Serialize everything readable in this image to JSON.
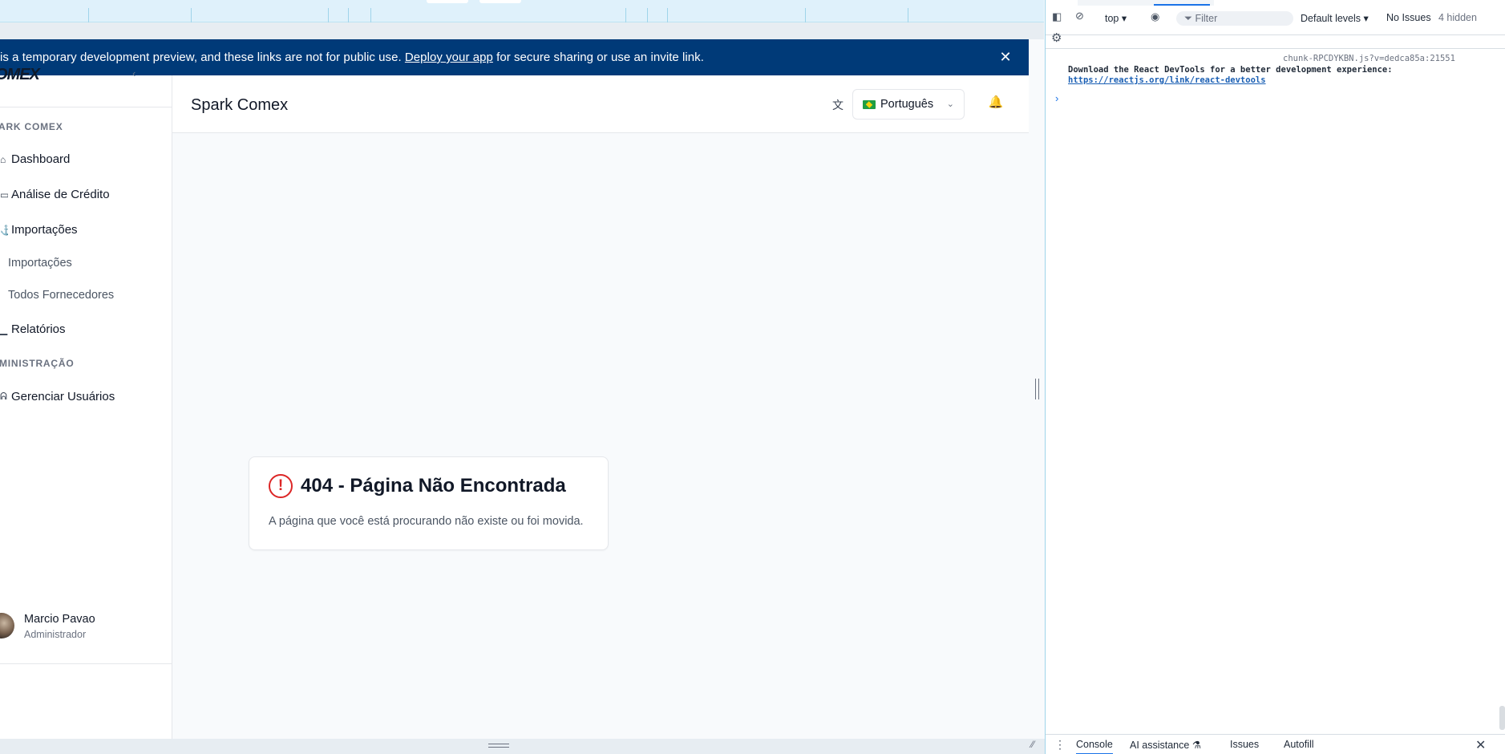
{
  "banner": {
    "text_before": "is a temporary development preview, and these links are not for public use. ",
    "link": "Deploy your app",
    "text_after": " for secure sharing or use an invite link.",
    "close_icon": "close-icon"
  },
  "sidebar": {
    "logo": "OMEX",
    "section_main": "ARK COMEX",
    "items": [
      {
        "label": "Dashboard",
        "icon": "home-icon"
      },
      {
        "label": "Análise de Crédito",
        "icon": "credit-card-icon"
      },
      {
        "label": "Importações",
        "icon": "ship-icon"
      }
    ],
    "subitems": [
      {
        "label": "Importações"
      },
      {
        "label": "Todos Fornecedores"
      }
    ],
    "reports": {
      "label": "Relatórios",
      "icon": "chart-icon"
    },
    "section_admin": "MINISTRAÇÃO",
    "admin_items": [
      {
        "label": "Gerenciar Usuários",
        "icon": "users-icon"
      }
    ],
    "user": {
      "name": "Marcio Pavao",
      "role": "Administrador"
    }
  },
  "header": {
    "title": "Spark Comex",
    "language": "Português"
  },
  "error_card": {
    "title": "404 - Página Não Encontrada",
    "message": "A página que você está procurando não existe ou foi movida."
  },
  "devtools": {
    "context": "top",
    "filter_placeholder": "Filter",
    "levels": "Default levels",
    "issues": "No Issues",
    "hidden": "4 hidden",
    "source": "chunk-RPCDYKBN.js?v=dedca85a:21551",
    "message": "Download the React DevTools for a better development experience:",
    "link": "https://reactjs.org/link/react-devtools",
    "tabs": [
      "Console",
      "AI assistance",
      "Issues",
      "Autofill"
    ]
  }
}
